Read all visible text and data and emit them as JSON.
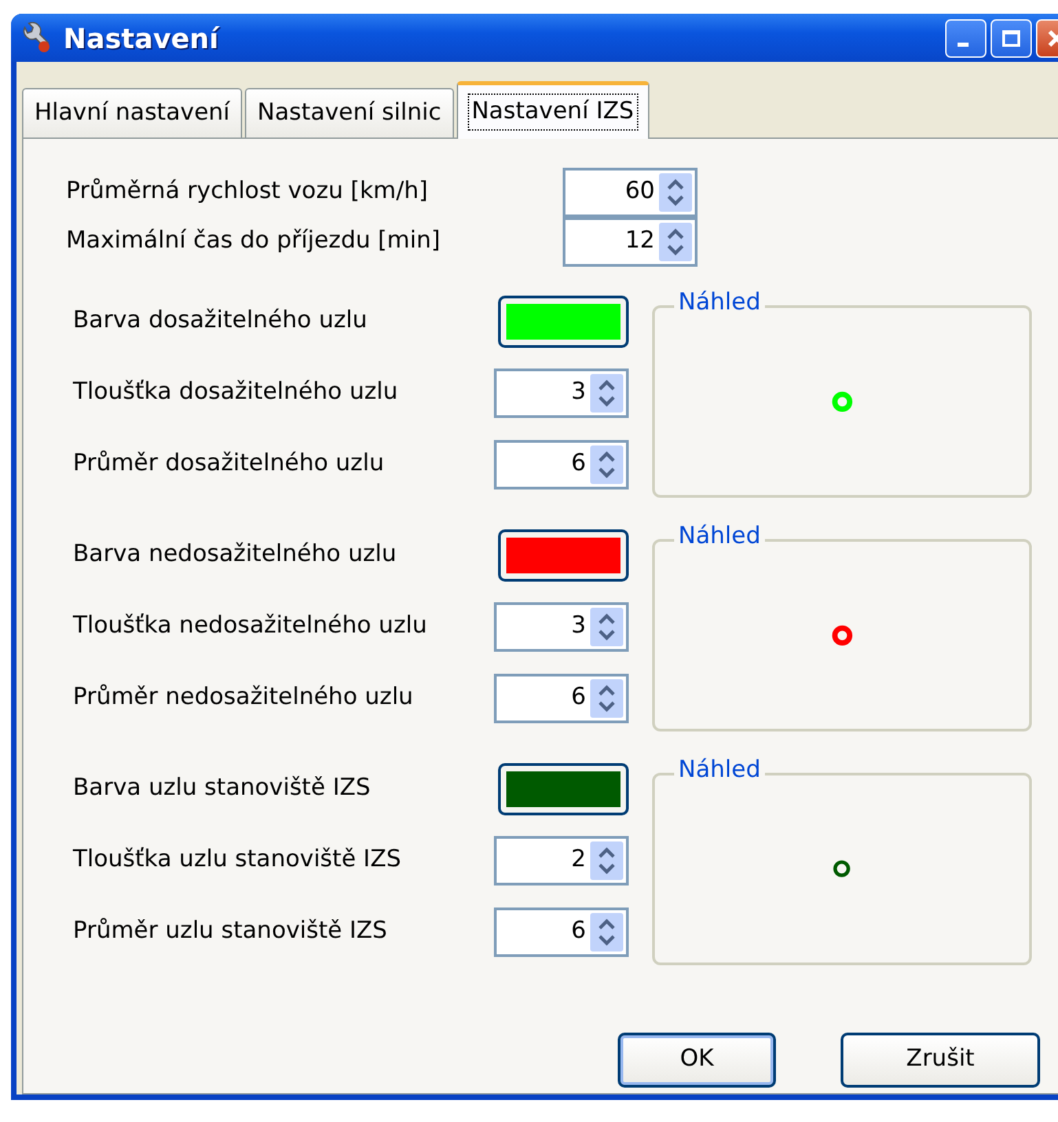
{
  "window": {
    "title": "Nastavení"
  },
  "tabs": [
    {
      "label": "Hlavní nastavení",
      "selected": false
    },
    {
      "label": "Nastavení silnic",
      "selected": false
    },
    {
      "label": "Nastavení IZS",
      "selected": true
    }
  ],
  "fields": [
    {
      "label": "Průměrná rychlost vozu [km/h]",
      "value": "60"
    },
    {
      "label": "Maximální čas do příjezdu [min]",
      "value": "12"
    }
  ],
  "node_groups": [
    {
      "color_label": "Barva dosažitelného uzlu",
      "color": "#00ff00",
      "thickness_label": "Tloušťka dosažitelného uzlu",
      "thickness": "3",
      "diameter_label": "Průměr dosažitelného uzlu",
      "diameter": "6",
      "preview_title": "Náhled"
    },
    {
      "color_label": "Barva nedosažitelného uzlu",
      "color": "#ff0000",
      "thickness_label": "Tloušťka nedosažitelného uzlu",
      "thickness": "3",
      "diameter_label": "Průměr nedosažitelného uzlu",
      "diameter": "6",
      "preview_title": "Náhled"
    },
    {
      "color_label": "Barva uzlu stanoviště IZS",
      "color": "#005a00",
      "thickness_label": "Tloušťka uzlu stanoviště IZS",
      "thickness": "2",
      "diameter_label": "Průměr uzlu stanoviště IZS",
      "diameter": "6",
      "preview_title": "Náhled"
    }
  ],
  "buttons": [
    {
      "label": "OK",
      "default": true
    },
    {
      "label": "Zrušit",
      "default": false
    }
  ]
}
